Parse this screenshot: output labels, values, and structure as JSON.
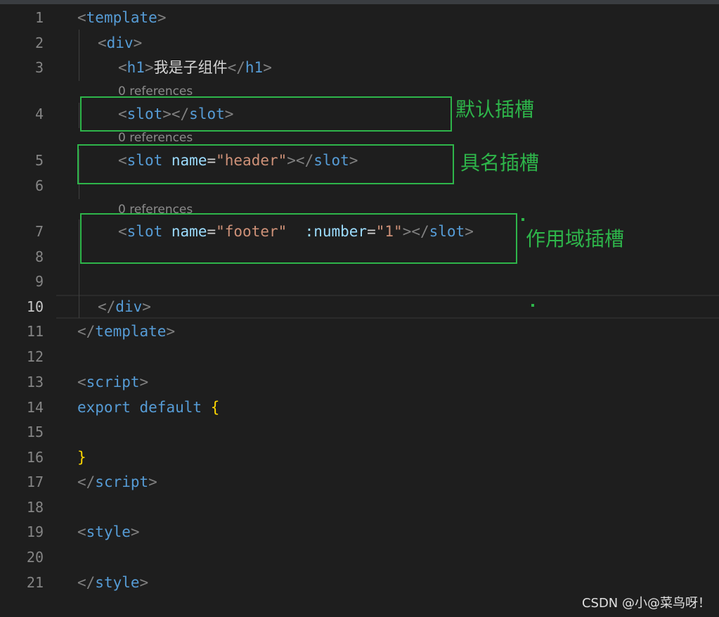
{
  "gutter": {
    "line_numbers": [
      "1",
      "2",
      "3",
      "4",
      "5",
      "6",
      "7",
      "8",
      "9",
      "10",
      "11",
      "12",
      "13",
      "14",
      "15",
      "16",
      "17",
      "18",
      "19",
      "20",
      "21"
    ],
    "active_line": "10"
  },
  "code_lens": {
    "label": "0 references"
  },
  "code": {
    "template_tag": "template",
    "div_tag": "div",
    "h1_tag": "h1",
    "h1_text": "我是子组件",
    "slot_tag": "slot",
    "name_attr": "name",
    "header_value": "\"header\"",
    "footer_value": "\"footer\"",
    "number_attr": ":number",
    "number_value": "\"1\"",
    "script_tag": "script",
    "export_kw": "export",
    "default_kw": "default",
    "open_brace": "{",
    "close_brace": "}",
    "style_tag": "style"
  },
  "annotations": {
    "default_slot": "默认插槽",
    "named_slot": "具名插槽",
    "scoped_slot": "作用域插槽",
    "color": "#2eb54a"
  },
  "watermark": "CSDN @小@菜鸟呀！",
  "colors": {
    "background": "#1e1e1e",
    "tag": "#569cd6",
    "attribute": "#9cdcfe",
    "string": "#ce9178",
    "brace": "#ffd700"
  }
}
